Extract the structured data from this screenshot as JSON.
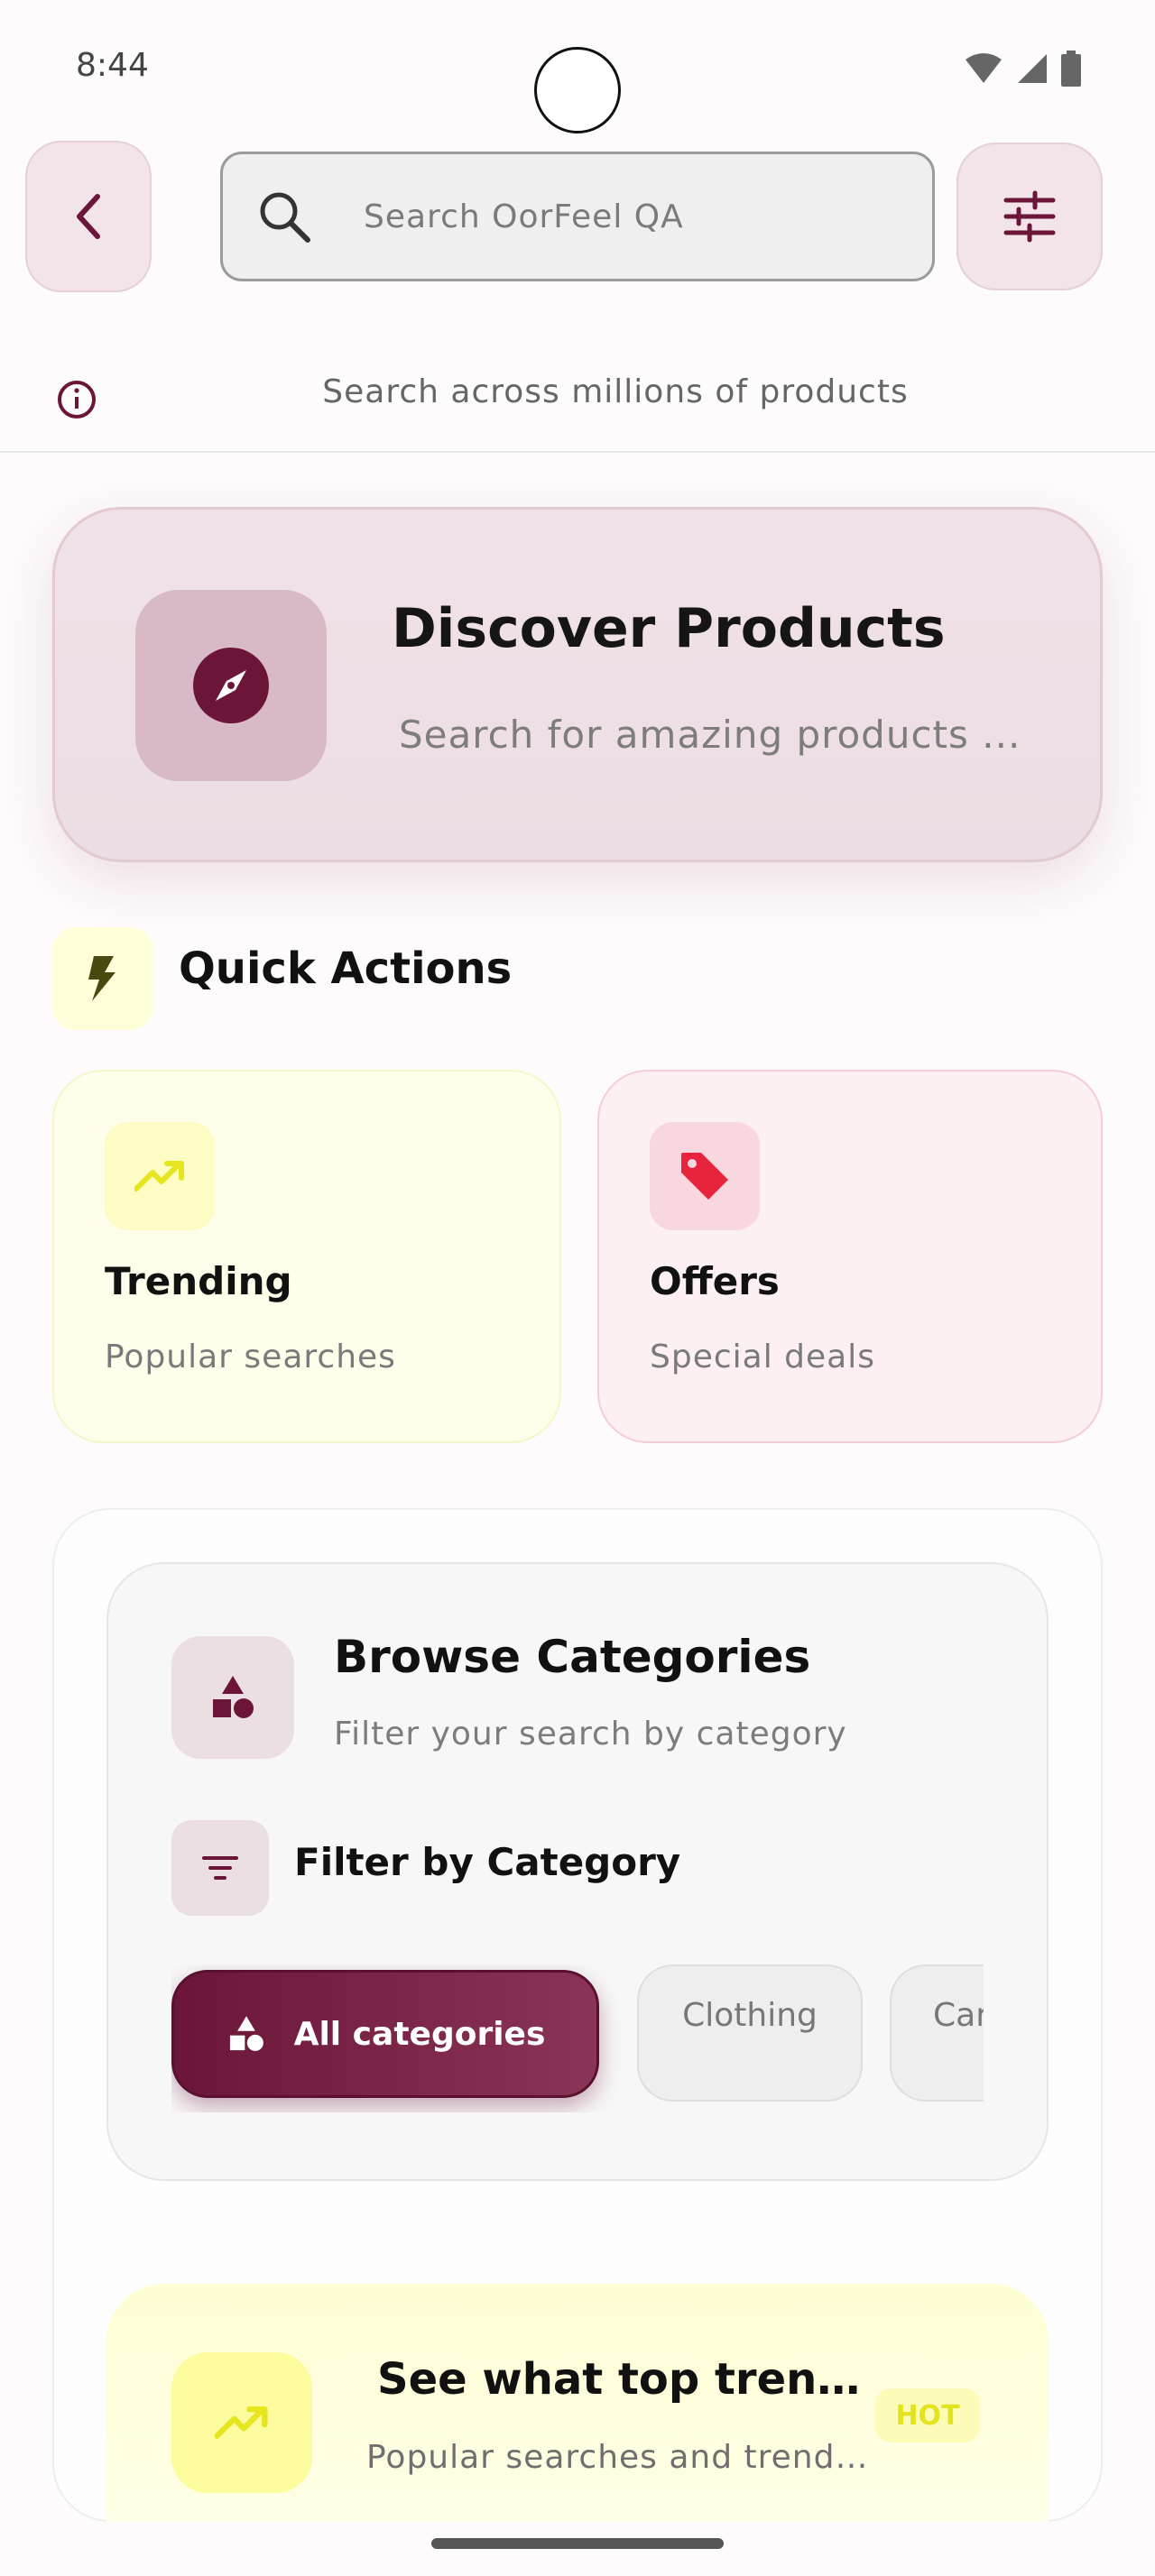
{
  "status_bar": {
    "time": "8:44"
  },
  "search": {
    "placeholder": "Search OorFeel QA"
  },
  "info": {
    "text": "Search across millions of products"
  },
  "discover": {
    "title": "Discover Products",
    "subtitle": "Search for amazing products ..."
  },
  "quick_actions": {
    "title": "Quick Actions",
    "cards": [
      {
        "title": "Trending",
        "subtitle": "Popular searches"
      },
      {
        "title": "Offers",
        "subtitle": "Special deals"
      }
    ]
  },
  "browse": {
    "title": "Browse Categories",
    "subtitle": "Filter your search by category",
    "filter_title": "Filter by Category",
    "chips": [
      "All categories",
      "Clothing",
      "Car"
    ]
  },
  "trending_banner": {
    "title": "See what top trendi...",
    "subtitle": "Popular searches and trendi...",
    "badge": "HOT"
  },
  "colors": {
    "brand": "#6b1538",
    "brand_light": "#f3e4ea",
    "trend_yellow": "#e6e620",
    "offer_red": "#e8243c"
  }
}
